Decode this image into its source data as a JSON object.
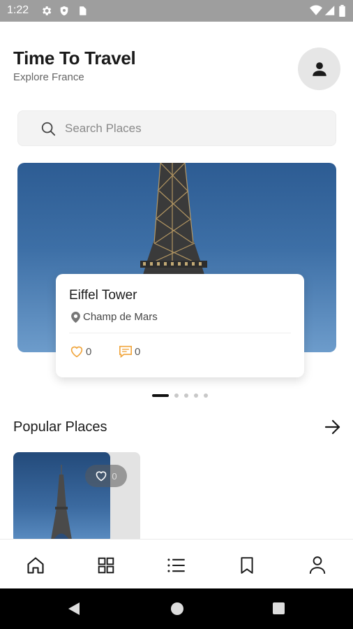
{
  "status_bar": {
    "time": "1:22",
    "left_icons": [
      "gear-icon",
      "shield-icon",
      "sim-card-icon"
    ],
    "right_icons": [
      "wifi-icon",
      "signal-icon",
      "battery-icon"
    ]
  },
  "header": {
    "title": "Time To Travel",
    "subtitle": "Explore France",
    "avatar_icon": "person-icon"
  },
  "search": {
    "placeholder": "Search Places",
    "value": ""
  },
  "featured": {
    "title": "Eiffel Tower",
    "location": "Champ de Mars",
    "likes": "0",
    "comments": "0",
    "slide_count": 5,
    "active_slide": 1
  },
  "popular": {
    "title": "Popular Places",
    "items": [
      {
        "likes": "0"
      }
    ]
  },
  "bottom_nav": {
    "items": [
      "home-icon",
      "grid-icon",
      "list-icon",
      "bookmark-icon",
      "profile-icon"
    ]
  },
  "colors": {
    "accent": "#f0a43a",
    "status_bar": "#9e9e9e",
    "sky": "#3d6fa6"
  }
}
